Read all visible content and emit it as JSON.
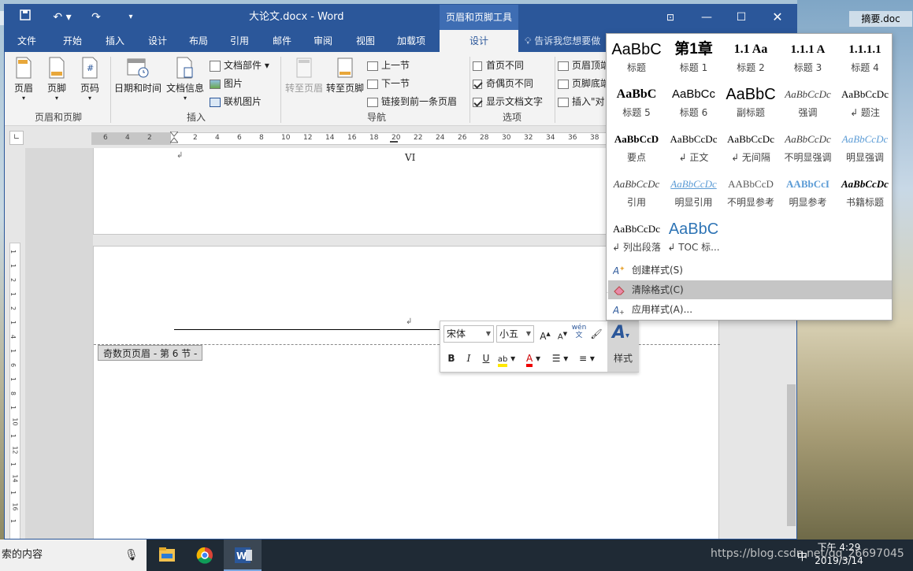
{
  "window": {
    "doc_title": "大论文.docx - Word",
    "context_tool_title": "页眉和页脚工具"
  },
  "tabs": [
    {
      "label": "文件"
    },
    {
      "label": "开始"
    },
    {
      "label": "插入"
    },
    {
      "label": "设计"
    },
    {
      "label": "布局"
    },
    {
      "label": "引用"
    },
    {
      "label": "邮件"
    },
    {
      "label": "审阅"
    },
    {
      "label": "视图"
    },
    {
      "label": "加载项"
    },
    {
      "label": "设计"
    }
  ],
  "tell_me": "告诉我您想要做",
  "ribbon": {
    "header": "页眉",
    "footer": "页脚",
    "page_number": "页码",
    "group_header_footer": "页眉和页脚",
    "date_time": "日期和时间",
    "doc_info": "文档信息",
    "doc_parts": "文档部件",
    "picture": "图片",
    "online_picture": "联机图片",
    "group_insert": "插入",
    "goto_header": "转至页眉",
    "goto_footer": "转至页脚",
    "prev_section": "上一节",
    "next_section": "下一节",
    "link_previous": "链接到前一条页眉",
    "group_navigation": "导航",
    "diff_first": "首页不同",
    "diff_odd_even": "奇偶页不同",
    "show_doc_text": "显示文档文字",
    "group_options": "选项",
    "header_top": "页眉顶端",
    "footer_bottom": "页脚底端",
    "insert_align": "插入\"对"
  },
  "options_state": {
    "diff_first": false,
    "diff_odd_even": true,
    "show_doc_text": true
  },
  "ruler_ticks": [
    "6",
    "4",
    "2",
    "2",
    "4",
    "6",
    "8",
    "10",
    "12",
    "14",
    "16",
    "18",
    "20",
    "22",
    "24",
    "26",
    "28",
    "30",
    "32",
    "34",
    "36",
    "38"
  ],
  "vruler_ticks": [
    "1",
    "1",
    "2",
    "1",
    "2",
    "1",
    "4",
    "1",
    "6",
    "1",
    "8",
    "1",
    "10",
    "1",
    "12",
    "1",
    "14",
    "1",
    "16",
    "1"
  ],
  "document": {
    "page_number_text": "VI",
    "header_tag": "奇数页页眉 - 第 6 节 -"
  },
  "minibar": {
    "font": "宋体",
    "size": "小五",
    "styles_label": "样式",
    "wen": "wén\n文"
  },
  "gallery": {
    "styles": [
      {
        "preview": "AaBbC",
        "name": "标题"
      },
      {
        "preview": "第1章",
        "name": "标题 1"
      },
      {
        "preview": "1.1 Aa",
        "name": "标题 2"
      },
      {
        "preview": "1.1.1 A",
        "name": "标题 3"
      },
      {
        "preview": "1.1.1.1",
        "name": "标题 4"
      },
      {
        "preview": "AaBbC",
        "name": "标题 5"
      },
      {
        "preview": "AaBbCc",
        "name": "标题 6"
      },
      {
        "preview": "AaBbC",
        "name": "副标题"
      },
      {
        "preview": "AaBbCcDc",
        "name": "强调"
      },
      {
        "preview": "AaBbCcDc",
        "name": "↲ 题注"
      },
      {
        "preview": "AaBbCcD",
        "name": "要点"
      },
      {
        "preview": "AaBbCcDc",
        "name": "↲ 正文"
      },
      {
        "preview": "AaBbCcDc",
        "name": "↲ 无间隔"
      },
      {
        "preview": "AaBbCcDc",
        "name": "不明显强调"
      },
      {
        "preview": "AaBbCcDc",
        "name": "明显强调"
      },
      {
        "preview": "AaBbCcDc",
        "name": "引用"
      },
      {
        "preview": "AaBbCcDc",
        "name": "明显引用"
      },
      {
        "preview": "AABbCcD",
        "name": "不明显参考"
      },
      {
        "preview": "AABbCcI",
        "name": "明显参考"
      },
      {
        "preview": "AaBbCcDc",
        "name": "书籍标题"
      },
      {
        "preview": "AaBbCcDc",
        "name": "↲ 列出段落"
      },
      {
        "preview": "AaBbC",
        "name": "↲ TOC 标..."
      }
    ],
    "commands": [
      {
        "label": "创建样式(S)"
      },
      {
        "label": "清除格式(C)"
      },
      {
        "label": "应用样式(A)..."
      }
    ]
  },
  "desktop": {
    "icon_label": "摘要.doc"
  },
  "taskbar": {
    "search_text": "索的内容",
    "time": "下午 4:29",
    "date": "2019/3/14",
    "watermark": "https://blog.csdn.net/qq_26697045",
    "ime": "中"
  },
  "colors": {
    "word_blue": "#2b579a",
    "accent_heading": "#2e74b5"
  }
}
